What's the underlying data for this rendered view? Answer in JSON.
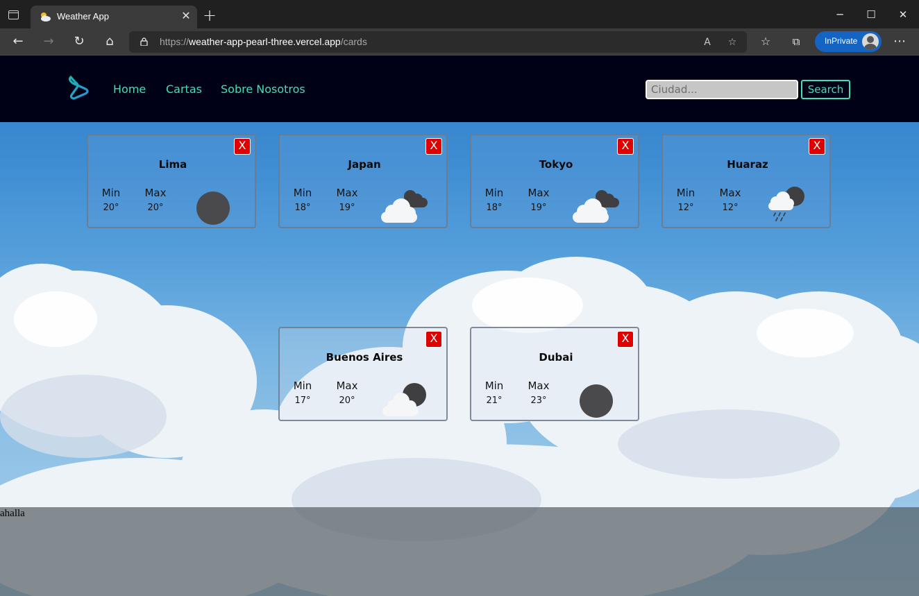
{
  "browser": {
    "tab_title": "Weather App",
    "url_scheme": "https://",
    "url_host": "weather-app-pearl-three.vercel.app",
    "url_path": "/cards",
    "inprivate_label": "InPrivate"
  },
  "nav": {
    "links": [
      "Home",
      "Cartas",
      "Sobre Nosotros"
    ],
    "search_placeholder": "Ciudad...",
    "search_button": "Search"
  },
  "cards": [
    {
      "city": "Lima",
      "min_label": "Min",
      "max_label": "Max",
      "min": "20°",
      "max": "20°",
      "icon": "dark-circle-icon"
    },
    {
      "city": "Japan",
      "min_label": "Min",
      "max_label": "Max",
      "min": "18°",
      "max": "19°",
      "icon": "broken-clouds-icon"
    },
    {
      "city": "Tokyo",
      "min_label": "Min",
      "max_label": "Max",
      "min": "18°",
      "max": "19°",
      "icon": "broken-clouds-icon"
    },
    {
      "city": "Huaraz",
      "min_label": "Min",
      "max_label": "Max",
      "min": "12°",
      "max": "12°",
      "icon": "rain-night-icon"
    },
    {
      "city": "Buenos Aires",
      "min_label": "Min",
      "max_label": "Max",
      "min": "17°",
      "max": "20°",
      "icon": "partly-cloudy-night-icon"
    },
    {
      "city": "Dubai",
      "min_label": "Min",
      "max_label": "Max",
      "min": "21°",
      "max": "23°",
      "icon": "dark-circle-icon"
    }
  ],
  "close_label": "X",
  "footer_text": "ahalla",
  "colors": {
    "accent": "#3fe0b5",
    "navbar_bg": "#000016",
    "close_red": "#e00000"
  }
}
